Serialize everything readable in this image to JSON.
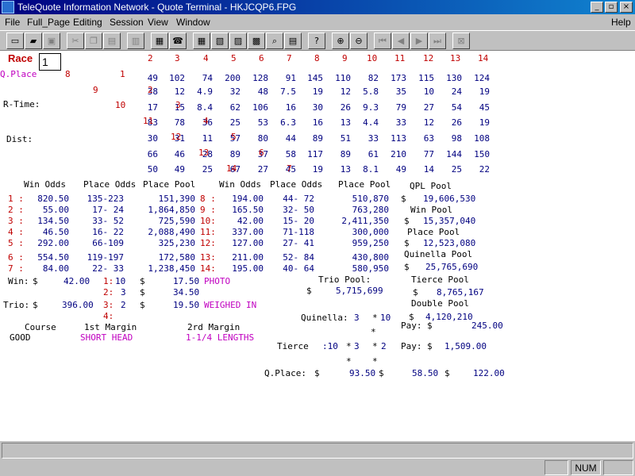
{
  "window": {
    "title": "TeleQuote Information Network - Quote Terminal - HKJCQP6.FPG",
    "min_glyph": "_",
    "max_glyph": "▫",
    "close_glyph": "×"
  },
  "menu": [
    "File",
    "Full_Page",
    "Editing",
    "Session",
    "View",
    "Window"
  ],
  "help_label": "Help",
  "status": {
    "num": "NUM"
  },
  "race": {
    "label": "Race",
    "value": "1"
  },
  "labels": {
    "qplace": "Q.Place",
    "rtime": "R-Time:",
    "dist": "Dist:",
    "win_odds": "Win Odds",
    "place_odds": "Place Odds",
    "place_pool": "Place Pool",
    "qpl_pool": "QPL Pool",
    "win_pool": "Win Pool",
    "place_pool2": "Place Pool",
    "quinella_pool": "Quinella Pool",
    "trio_pool": "Trio Pool:",
    "tierce_pool": "Tierce Pool",
    "double_pool": "Double Pool",
    "win": "Win:",
    "trio": "Trio:",
    "dollar": "$",
    "course": "Course",
    "first_margin": "1st Margin",
    "second_margin": "2rd Margin",
    "quinella": "Quinella:",
    "tierce": "Tierce",
    "pay": "Pay:",
    "qplace_colon": "Q.Place:"
  },
  "values": {
    "qpl_pool": "19,606,530",
    "win_pool": "15,357,040",
    "place_pool": "12,523,080",
    "quinella_pool": "25,765,690",
    "trio_pool": "5,715,699",
    "tierce_pool": "8,765,167",
    "double_pool": "4,120,210",
    "win_amount": "42.00",
    "trio_amount": "396.00",
    "course": "GOOD",
    "first_margin": "SHORT HEAD",
    "second_margin": "1-1/4 LENGTHS",
    "photo": "PHOTO",
    "weighed_in": "WEIGHED IN",
    "quinella_combo": [
      "3",
      "*",
      "10"
    ],
    "quinella_pay": "245.00",
    "tierce_combo": [
      ":10",
      "*",
      "3",
      "*",
      "2"
    ],
    "tierce_pay": "1,509.00",
    "qplace_pays": [
      "93.50",
      "58.50",
      "122.00"
    ],
    "place_results": [
      {
        "pos": "1:",
        "horse": "10",
        "amount": "17.50"
      },
      {
        "pos": "2:",
        "horse": "3",
        "amount": "34.50"
      },
      {
        "pos": "3:",
        "horse": "2",
        "amount": "19.50"
      },
      {
        "pos": "4:",
        "horse": "",
        "amount": ""
      }
    ]
  },
  "matrix": {
    "header": [
      "2",
      "3",
      "4",
      "5",
      "6",
      "7",
      "8",
      "9",
      "10",
      "11",
      "12",
      "13",
      "14"
    ],
    "row_labels": [
      "8",
      "9",
      "10",
      "11",
      "12",
      "13",
      "14"
    ],
    "diag_labels": [
      "1",
      "2",
      "3",
      "4",
      "5",
      "6",
      "7"
    ],
    "rows": [
      [
        "49",
        "102",
        "74",
        "200",
        "128",
        "91",
        "145",
        "110",
        "82",
        "173",
        "115",
        "130",
        "124"
      ],
      [
        "38",
        "12",
        "4.9",
        "32",
        "48",
        "7.5",
        "19",
        "12",
        "5.8",
        "35",
        "10",
        "24",
        "19"
      ],
      [
        "17",
        "15",
        "8.4",
        "62",
        "106",
        "16",
        "30",
        "26",
        "9.3",
        "79",
        "27",
        "54",
        "45"
      ],
      [
        "83",
        "78",
        "36",
        "25",
        "53",
        "6.3",
        "16",
        "13",
        "4.4",
        "33",
        "12",
        "26",
        "19"
      ],
      [
        "30",
        "31",
        "11",
        "57",
        "80",
        "44",
        "89",
        "51",
        "33",
        "113",
        "63",
        "98",
        "108"
      ],
      [
        "66",
        "46",
        "28",
        "89",
        "37",
        "58",
        "117",
        "89",
        "61",
        "210",
        "77",
        "144",
        "150"
      ],
      [
        "50",
        "49",
        "25",
        "67",
        "27",
        "45",
        "19",
        "13",
        "8.1",
        "49",
        "14",
        "25",
        "22"
      ]
    ]
  },
  "odds": {
    "left": [
      {
        "n": "1 :",
        "win": "820.50",
        "place": "135-223",
        "pool": "151,390"
      },
      {
        "n": "2 :",
        "win": "55.00",
        "place": "17- 24",
        "pool": "1,864,850"
      },
      {
        "n": "3 :",
        "win": "134.50",
        "place": "33- 52",
        "pool": "725,590"
      },
      {
        "n": "4 :",
        "win": "46.50",
        "place": "16- 22",
        "pool": "2,088,490"
      },
      {
        "n": "5 :",
        "win": "292.00",
        "place": "66-109",
        "pool": "325,230"
      },
      {
        "n": "6 :",
        "win": "554.50",
        "place": "119-197",
        "pool": "172,580"
      },
      {
        "n": "7 :",
        "win": "84.00",
        "place": "22- 33",
        "pool": "1,238,450"
      }
    ],
    "right": [
      {
        "n": "8 :",
        "win": "194.00",
        "place": "44- 72",
        "pool": "510,870"
      },
      {
        "n": "9 :",
        "win": "165.50",
        "place": "32- 50",
        "pool": "763,280"
      },
      {
        "n": "10:",
        "win": "42.00",
        "place": "15- 20",
        "pool": "2,411,350"
      },
      {
        "n": "11:",
        "win": "337.00",
        "place": "71-118",
        "pool": "300,000"
      },
      {
        "n": "12:",
        "win": "127.00",
        "place": "27- 41",
        "pool": "959,250"
      },
      {
        "n": "13:",
        "win": "211.00",
        "place": "52- 84",
        "pool": "430,800"
      },
      {
        "n": "14:",
        "win": "195.00",
        "place": "40- 64",
        "pool": "580,950"
      }
    ]
  }
}
